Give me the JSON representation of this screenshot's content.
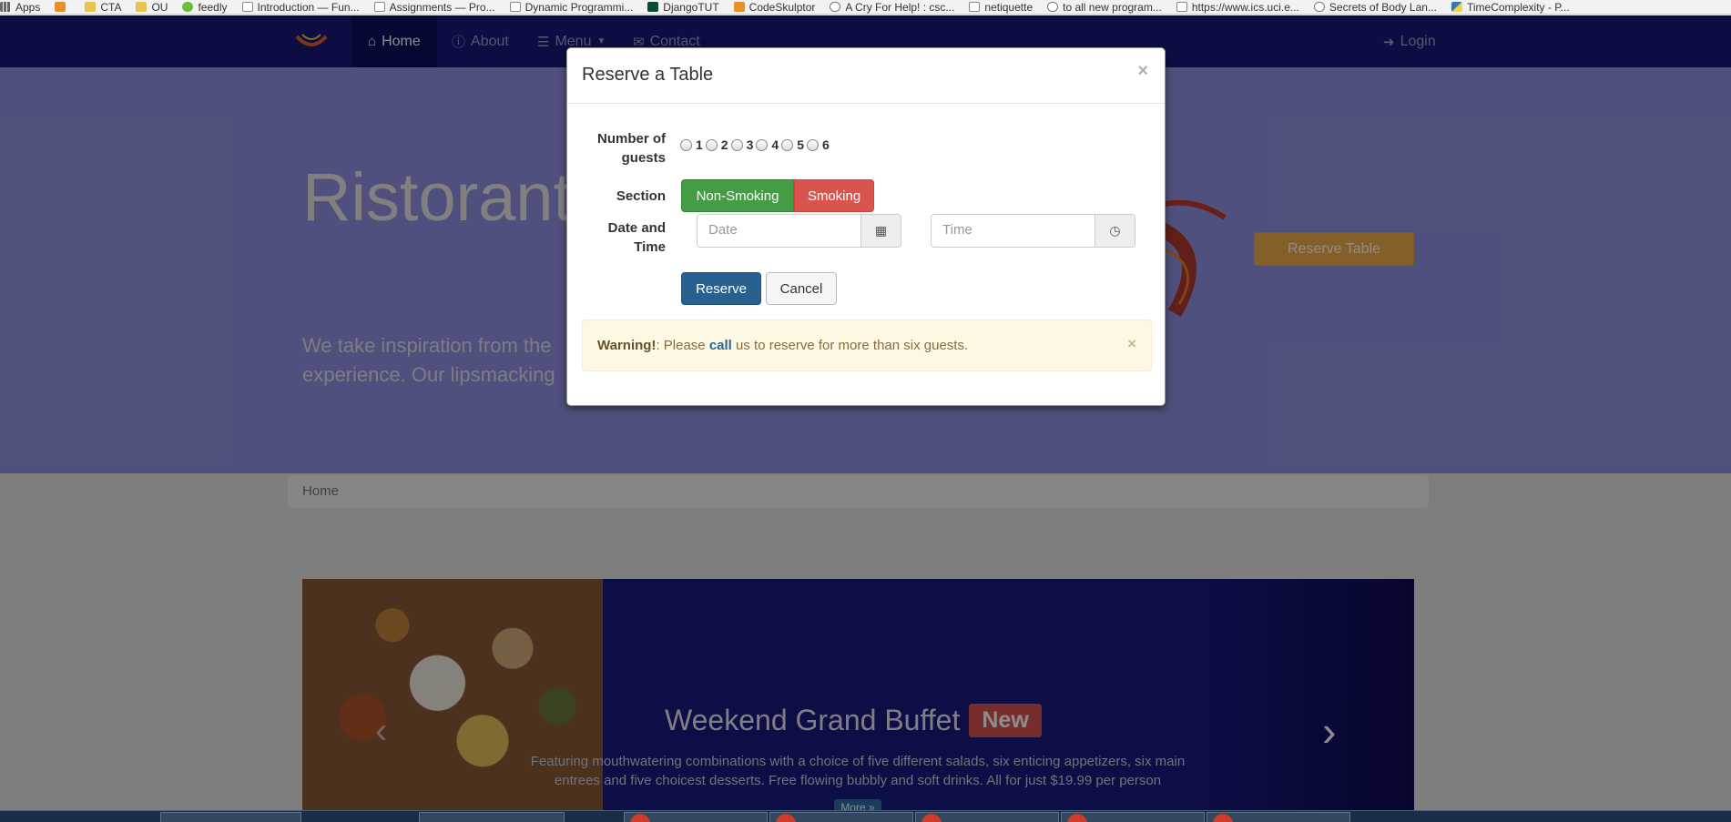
{
  "bookmarks": [
    "Apps",
    "",
    "CTA",
    "OU",
    "feedly",
    "Introduction — Fun...",
    "Assignments — Pro...",
    "Dynamic Programmi...",
    "DjangoTUT",
    "CodeSkulptor",
    "A Cry For Help! : csc...",
    "netiquette",
    "to all new program...",
    "https://www.ics.uci.e...",
    "Secrets of Body Lan...",
    "TimeComplexity - P..."
  ],
  "nav": {
    "home": "Home",
    "about": "About",
    "menu": "Menu",
    "contact": "Contact",
    "login": "Login"
  },
  "jumbotron": {
    "title": "Ristorante",
    "text": "We take inspiration from the experience. Our lipsmacking",
    "reserve_button": "Reserve Table"
  },
  "breadcrumb": "Home",
  "carousel": {
    "heading": "Weekend Grand Buffet",
    "badge": "New",
    "description": "Featuring mouthwatering combinations with a choice of five different salads, six enticing appetizers, six main entrees and five choicest desserts. Free flowing bubbly and soft drinks. All for just $19.99 per person",
    "more": "More »"
  },
  "modal": {
    "title": "Reserve a Table",
    "close": "×",
    "guests_label": "Number of guests",
    "guest_options": [
      "1",
      "2",
      "3",
      "4",
      "5",
      "6"
    ],
    "section_label": "Section",
    "non_smoking": "Non-Smoking",
    "smoking": "Smoking",
    "datetime_label": "Date and Time",
    "date_placeholder": "Date",
    "time_placeholder": "Time",
    "reserve": "Reserve",
    "cancel": "Cancel",
    "alert": {
      "strong": "Warning!",
      "before": ": Please ",
      "link": "call",
      "after": " us to reserve for more than six guests.",
      "close": "×"
    }
  },
  "colors": {
    "navbar": "#19197a",
    "jumbotron": "#9393e6",
    "success": "#449d44",
    "danger": "#d9534f",
    "primary": "#286090",
    "warning": "#f0ad4e"
  }
}
